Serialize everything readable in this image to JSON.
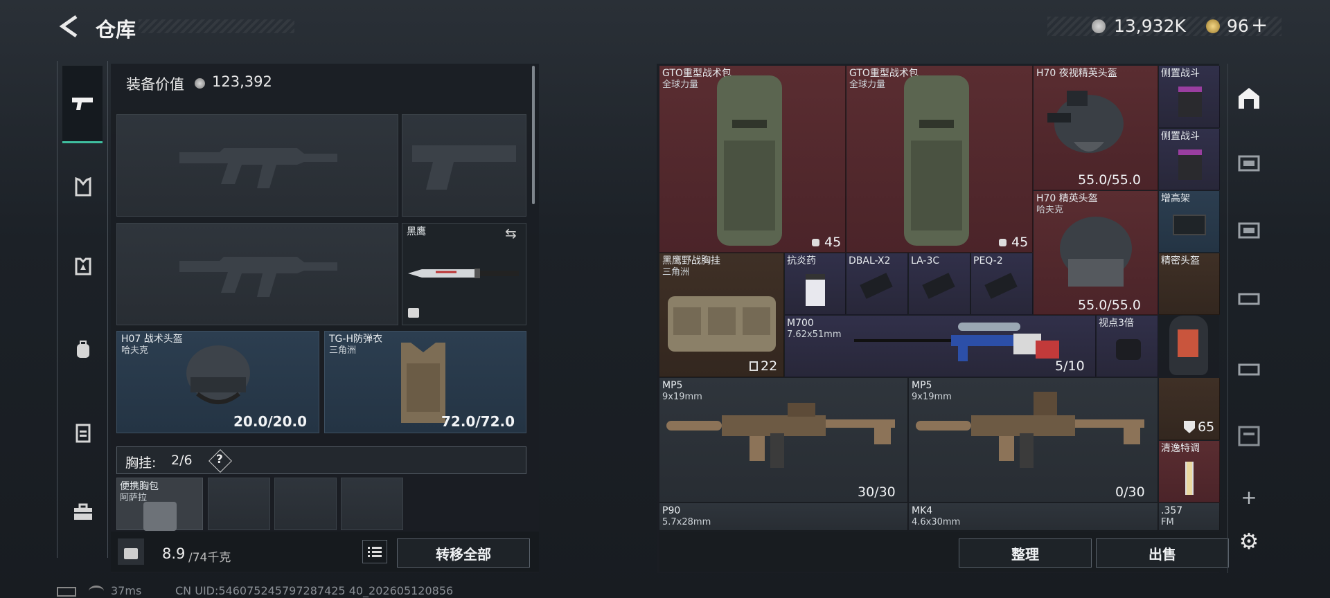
{
  "header": {
    "title": "仓库",
    "currency": "13,932K",
    "coins": "96",
    "plus": "+"
  },
  "left": {
    "equip_value_label": "装备价值",
    "equip_value": "123,392",
    "knife": {
      "name": "黑鹰"
    },
    "helmet": {
      "name": "H07 战术头盔",
      "maker": "哈夫克",
      "durability": "20.0/20.0"
    },
    "armor": {
      "name": "TG-H防弹衣",
      "maker": "三角洲",
      "durability": "72.0/72.0"
    },
    "chestrig": {
      "label": "胸挂:",
      "count": "2/6",
      "help": "?"
    },
    "pouch": {
      "name": "便携胸包",
      "maker": "阿萨拉"
    },
    "weight": "8.9",
    "weight_max": "/74千克",
    "transfer_all": "转移全部"
  },
  "grid": [
    {
      "id": "gto1",
      "name": "GTO重型战术包",
      "maker": "全球力量",
      "count": "45"
    },
    {
      "id": "gto2",
      "name": "GTO重型战术包",
      "maker": "全球力量",
      "count": "45"
    },
    {
      "id": "h70nv",
      "name": "H70 夜视精英头盔",
      "durability": "55.0/55.0"
    },
    {
      "id": "side1",
      "name": "侧置战斗"
    },
    {
      "id": "side2",
      "name": "侧置战斗"
    },
    {
      "id": "h70",
      "name": "H70 精英头盔",
      "maker": "哈夫克",
      "durability": "55.0/55.0"
    },
    {
      "id": "riser",
      "name": "增高架"
    },
    {
      "id": "blackhawk",
      "name": "黑鹰野战胸挂",
      "maker": "三角洲",
      "count": "22"
    },
    {
      "id": "antiinf",
      "name": "抗炎药"
    },
    {
      "id": "dbal",
      "name": "DBAL-X2"
    },
    {
      "id": "la3c",
      "name": "LA-3C"
    },
    {
      "id": "peq2",
      "name": "PEQ-2"
    },
    {
      "id": "precision",
      "name": "精密头盔"
    },
    {
      "id": "m700",
      "name": "M700",
      "caliber": "7.62x51mm",
      "ammo": "5/10"
    },
    {
      "id": "scope3",
      "name": "视点3倍"
    },
    {
      "id": "mp5a",
      "name": "MP5",
      "caliber": "9x19mm",
      "ammo": "30/30"
    },
    {
      "id": "mp5b",
      "name": "MP5",
      "caliber": "9x19mm",
      "ammo": "0/30"
    },
    {
      "id": "shield",
      "count": "65"
    },
    {
      "id": "drink",
      "name": "清逸特调"
    },
    {
      "id": "p90",
      "name": "P90",
      "caliber": "5.7x28mm"
    },
    {
      "id": "mk4",
      "name": "MK4",
      "caliber": "4.6x30mm"
    },
    {
      "id": "cal357",
      "name": ".357",
      "caliber": "FM"
    }
  ],
  "actions": {
    "sort": "整理",
    "sell": "出售"
  },
  "status": {
    "ping": "37ms",
    "uid": "CN UID:546075245797287425 40_202605120856"
  },
  "colors": {
    "red": "#5a2d31",
    "purple": "#31304a",
    "blue": "#2c3e50",
    "brown": "#3f3026",
    "accent": "#3fbf9f"
  }
}
